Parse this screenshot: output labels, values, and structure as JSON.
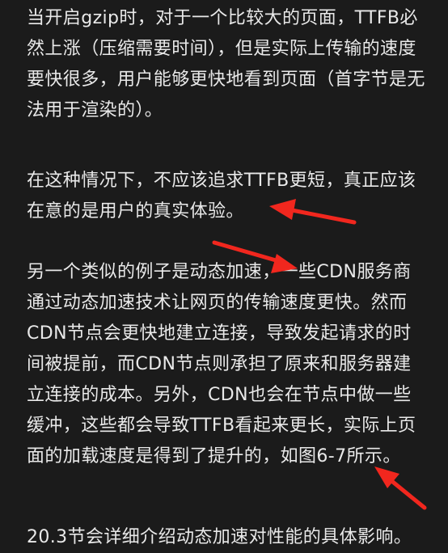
{
  "article": {
    "paragraphs": [
      {
        "lines": [
          "当开启gzip时，对于一个比较大的页面，TTFB必",
          "然上涨（压缩需要时间），但是实际上传输的速度",
          "要快很多，用户能够更快地看到页面（首字节是无",
          "法用于渲染的）。"
        ]
      },
      {
        "lines": [
          "在这种情况下，不应该追求TTFB更短，真正应该",
          "在意的是用户的真实体验。"
        ]
      },
      {
        "lines": [
          "另一个类似的例子是动态加速，一些CDN服务商",
          "通过动态加速技术让网页的传输速度更快。然而",
          "CDN节点会更快地建立连接，导致发起请求的时",
          "间被提前，而CDN节点则承担了原来和服务器建",
          "立连接的成本。另外，CDN也会在节点中做一些",
          "缓冲，这些都会导致TTFB看起来更长，实际上页",
          "面的加载速度是得到了提升的，如图6-7所示。"
        ]
      },
      {
        "lines": [
          "20.3节会详细介绍动态加速对性能的具体影响。"
        ]
      }
    ]
  },
  "annotations": {
    "arrow_color": "#f1271e",
    "arrows": [
      {
        "name": "arrow-pointing-to-ttfb-sentence"
      },
      {
        "name": "arrow-pointing-to-dynamic-acceleration"
      },
      {
        "name": "arrow-pointing-to-page-load-speed"
      }
    ]
  }
}
